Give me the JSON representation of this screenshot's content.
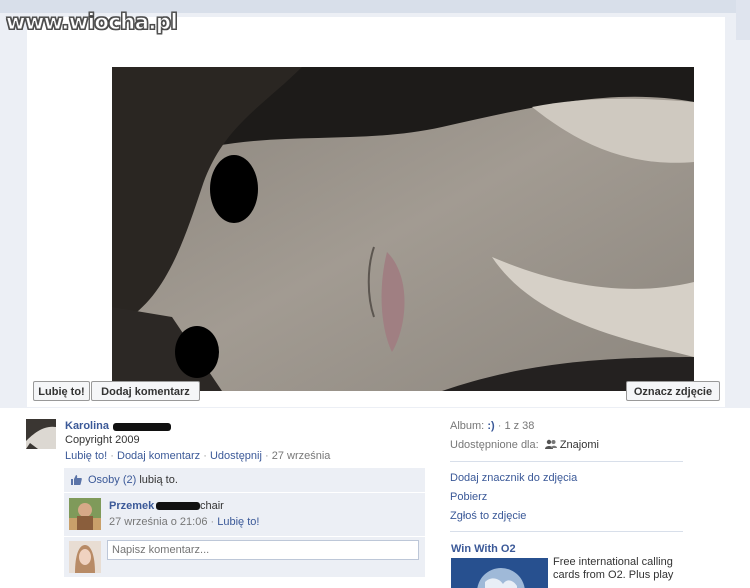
{
  "watermark": "www.wiocha.pl",
  "photo_actions": {
    "like": "Lubię to!",
    "comment": "Dodaj komentarz",
    "tag": "Oznacz zdjęcie"
  },
  "post": {
    "author": "Karolina",
    "caption": "Copyright 2009",
    "actions": {
      "like": "Lubię to!",
      "comment": "Dodaj komentarz",
      "share": "Udostępnij",
      "date": "27 września"
    },
    "likes": {
      "people": "Osoby (2)",
      "suffix": "lubią to."
    },
    "comments": [
      {
        "author": "Przemek",
        "trailing": "chair",
        "date": "27 września o 21:06",
        "like": "Lubię to!"
      }
    ],
    "comment_placeholder": "Napisz komentarz..."
  },
  "sidebar": {
    "album_label": "Album:",
    "album_value": ":)",
    "album_position": "1 z 38",
    "shared_label": "Udostępnione dla:",
    "shared_value": "Znajomi",
    "links": [
      "Dodaj znacznik do zdjęcia",
      "Pobierz",
      "Zgłoś to zdjęcie"
    ],
    "ad": {
      "title": "Win With O2",
      "text": "Free international calling cards from O2. Plus play"
    }
  }
}
